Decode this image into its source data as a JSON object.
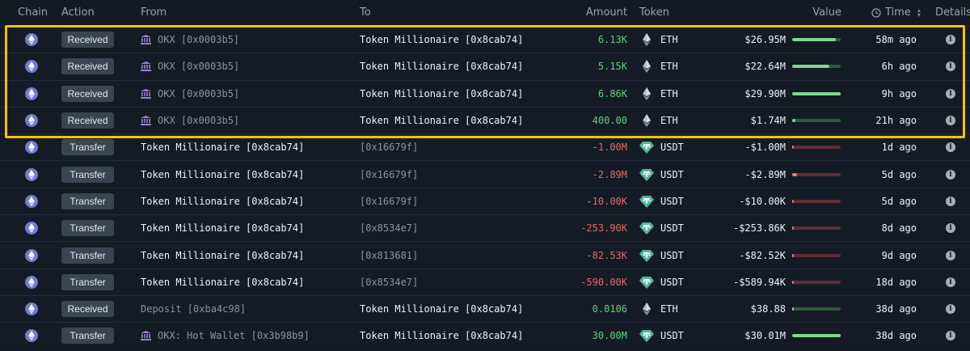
{
  "header": {
    "chain": "Chain",
    "action": "Action",
    "from": "From",
    "to": "To",
    "amount": "Amount",
    "token": "Token",
    "value": "Value",
    "time": "Time",
    "details": "Details"
  },
  "colors": {
    "positive": "#5fd07c",
    "negative": "#e26a6a",
    "highlight": "#f0c20e",
    "eth": "#6f79d8",
    "usdt": "#4fb59a"
  },
  "rows": [
    {
      "action": "Received",
      "from": "OKX [0x0003b5]",
      "from_icon": "bank-icon",
      "from_style": "dim",
      "to": "Token Millionaire [0x8cab74]",
      "to_style": "bright",
      "amount": "6.13K",
      "amount_sign": "pos",
      "token": "ETH",
      "token_icon": "eth-icon",
      "value": "$26.95M",
      "bar_fraction": 0.9,
      "bar_sign": "pos",
      "time": "58m ago"
    },
    {
      "action": "Received",
      "from": "OKX [0x0003b5]",
      "from_icon": "bank-icon",
      "from_style": "dim",
      "to": "Token Millionaire [0x8cab74]",
      "to_style": "bright",
      "amount": "5.15K",
      "amount_sign": "pos",
      "token": "ETH",
      "token_icon": "eth-icon",
      "value": "$22.64M",
      "bar_fraction": 0.76,
      "bar_sign": "pos",
      "time": "6h ago"
    },
    {
      "action": "Received",
      "from": "OKX [0x0003b5]",
      "from_icon": "bank-icon",
      "from_style": "dim",
      "to": "Token Millionaire [0x8cab74]",
      "to_style": "bright",
      "amount": "6.86K",
      "amount_sign": "pos",
      "token": "ETH",
      "token_icon": "eth-icon",
      "value": "$29.90M",
      "bar_fraction": 1.0,
      "bar_sign": "pos",
      "time": "9h ago"
    },
    {
      "action": "Received",
      "from": "OKX [0x0003b5]",
      "from_icon": "bank-icon",
      "from_style": "dim",
      "to": "Token Millionaire [0x8cab74]",
      "to_style": "bright",
      "amount": "400.00",
      "amount_sign": "pos",
      "token": "ETH",
      "token_icon": "eth-icon",
      "value": "$1.74M",
      "bar_fraction": 0.06,
      "bar_sign": "pos",
      "time": "21h ago"
    },
    {
      "action": "Transfer",
      "from": "Token Millionaire [0x8cab74]",
      "from_icon": "",
      "from_style": "bright",
      "to": "[0x16679f]",
      "to_style": "dim",
      "amount": "-1.00M",
      "amount_sign": "neg",
      "token": "USDT",
      "token_icon": "usdt-icon",
      "value": "-$1.00M",
      "bar_fraction": 0.04,
      "bar_sign": "neg",
      "time": "1d ago"
    },
    {
      "action": "Transfer",
      "from": "Token Millionaire [0x8cab74]",
      "from_icon": "",
      "from_style": "bright",
      "to": "[0x16679f]",
      "to_style": "dim",
      "amount": "-2.89M",
      "amount_sign": "neg",
      "token": "USDT",
      "token_icon": "usdt-icon",
      "value": "-$2.89M",
      "bar_fraction": 0.1,
      "bar_sign": "neg",
      "time": "5d ago"
    },
    {
      "action": "Transfer",
      "from": "Token Millionaire [0x8cab74]",
      "from_icon": "",
      "from_style": "bright",
      "to": "[0x16679f]",
      "to_style": "dim",
      "amount": "-10.00K",
      "amount_sign": "neg",
      "token": "USDT",
      "token_icon": "usdt-icon",
      "value": "-$10.00K",
      "bar_fraction": 0.01,
      "bar_sign": "neg",
      "time": "5d ago"
    },
    {
      "action": "Transfer",
      "from": "Token Millionaire [0x8cab74]",
      "from_icon": "",
      "from_style": "bright",
      "to": "[0x8534e7]",
      "to_style": "dim",
      "amount": "-253.90K",
      "amount_sign": "neg",
      "token": "USDT",
      "token_icon": "usdt-icon",
      "value": "-$253.86K",
      "bar_fraction": 0.01,
      "bar_sign": "neg",
      "time": "8d ago"
    },
    {
      "action": "Transfer",
      "from": "Token Millionaire [0x8cab74]",
      "from_icon": "",
      "from_style": "bright",
      "to": "[0x813681]",
      "to_style": "dim",
      "amount": "-82.53K",
      "amount_sign": "neg",
      "token": "USDT",
      "token_icon": "usdt-icon",
      "value": "-$82.52K",
      "bar_fraction": 0.01,
      "bar_sign": "neg",
      "time": "9d ago"
    },
    {
      "action": "Transfer",
      "from": "Token Millionaire [0x8cab74]",
      "from_icon": "",
      "from_style": "bright",
      "to": "[0x8534e7]",
      "to_style": "dim",
      "amount": "-590.00K",
      "amount_sign": "neg",
      "token": "USDT",
      "token_icon": "usdt-icon",
      "value": "-$589.94K",
      "bar_fraction": 0.02,
      "bar_sign": "neg",
      "time": "18d ago"
    },
    {
      "action": "Received",
      "from": "Deposit [0xba4c98]",
      "from_icon": "",
      "from_style": "dim",
      "to": "Token Millionaire [0x8cab74]",
      "to_style": "bright",
      "amount": "0.0106",
      "amount_sign": "pos",
      "token": "ETH",
      "token_icon": "eth-icon",
      "value": "$38.88",
      "bar_fraction": 0.0,
      "bar_sign": "pos",
      "time": "38d ago"
    },
    {
      "action": "Transfer",
      "from": "OKX: Hot Wallet [0x3b98b9]",
      "from_icon": "bank-icon",
      "from_style": "dim",
      "to": "Token Millionaire [0x8cab74]",
      "to_style": "bright",
      "amount": "30.00M",
      "amount_sign": "pos",
      "token": "USDT",
      "token_icon": "usdt-icon",
      "value": "$30.01M",
      "bar_fraction": 1.0,
      "bar_sign": "pos",
      "time": "38d ago"
    }
  ]
}
